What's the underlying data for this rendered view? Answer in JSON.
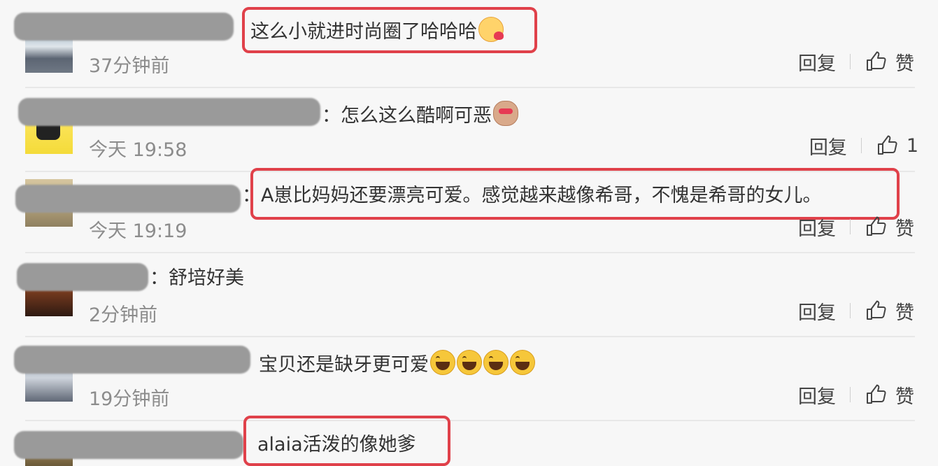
{
  "comments": [
    {
      "text": "这么小就进时尚圈了哈哈哈",
      "time": "37分钟前",
      "reply_label": "回复",
      "like_label": "赞",
      "emojis": [
        "kiss"
      ]
    },
    {
      "text": "：怎么这么酷啊可恶",
      "time": "今天 19:58",
      "reply_label": "回复",
      "like_label": "1",
      "emojis": [
        "monkey"
      ]
    },
    {
      "text": "：A崽比妈妈还要漂亮可爱。感觉越来越像希哥，不愧是希哥的女儿。",
      "time": "今天 19:19",
      "reply_label": "回复",
      "like_label": "赞",
      "emojis": []
    },
    {
      "text": "：舒培好美",
      "time": "2分钟前",
      "reply_label": "回复",
      "like_label": "赞",
      "emojis": []
    },
    {
      "text": "宝贝还是缺牙更可爱",
      "time": "19分钟前",
      "reply_label": "回复",
      "like_label": "赞",
      "emojis": [
        "laugh",
        "laugh",
        "laugh",
        "laugh"
      ]
    },
    {
      "text": "alaia活泼的像她爹",
      "time": "",
      "reply_label": "",
      "like_label": "",
      "emojis": []
    }
  ],
  "colors": {
    "background": "#f7f7f7",
    "highlight": "#e0414a",
    "muted": "#8c8c8c"
  },
  "icons": {
    "like": "thumbs-up-icon",
    "emoji_kiss": "kiss-emoji-icon",
    "emoji_laugh": "laugh-emoji-icon",
    "emoji_monkey": "monkey-emoji-icon"
  }
}
